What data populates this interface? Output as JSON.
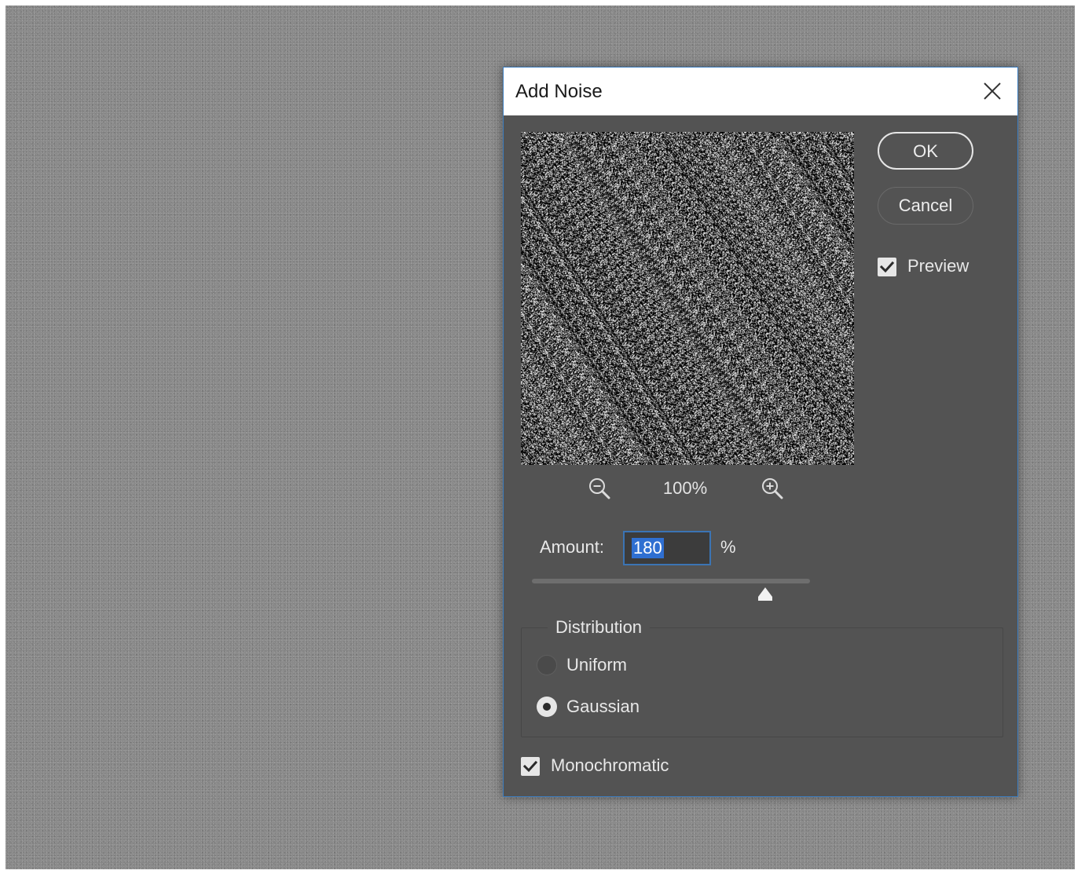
{
  "dialog": {
    "title": "Add Noise",
    "buttons": {
      "ok_label": "OK",
      "cancel_label": "Cancel"
    },
    "preview": {
      "label": "Preview",
      "checked": true
    },
    "zoom": {
      "level": "100%"
    },
    "amount": {
      "label": "Amount:",
      "value": "180",
      "unit": "%"
    },
    "distribution": {
      "title": "Distribution",
      "options": [
        {
          "label": "Uniform",
          "selected": false
        },
        {
          "label": "Gaussian",
          "selected": true
        }
      ]
    },
    "monochromatic": {
      "label": "Monochromatic",
      "checked": true
    }
  },
  "colors": {
    "dialog_bg": "#535353",
    "title_bg": "#ffffff",
    "accent_blue": "#3b74b4",
    "selection_blue": "#2f6fd1",
    "canvas_gray": "#8a8a8a"
  },
  "icons": {
    "close": "close-icon",
    "zoom_out": "zoom-out-icon",
    "zoom_in": "zoom-in-icon",
    "checkbox": "checkmark-icon",
    "slider_thumb": "triangle-up-icon"
  }
}
